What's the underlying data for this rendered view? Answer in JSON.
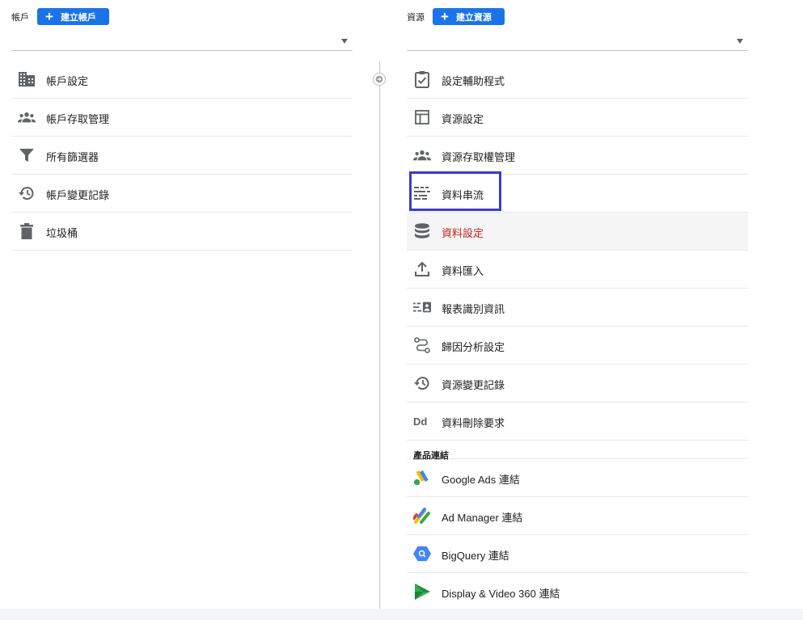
{
  "account": {
    "label": "帳戶",
    "create_button": "建立帳戶",
    "items": [
      {
        "label": "帳戶設定",
        "icon": "building-icon"
      },
      {
        "label": "帳戶存取管理",
        "icon": "people-icon"
      },
      {
        "label": "所有篩選器",
        "icon": "filter-icon"
      },
      {
        "label": "帳戶變更記錄",
        "icon": "history-icon"
      },
      {
        "label": "垃圾桶",
        "icon": "trash-icon"
      }
    ]
  },
  "property": {
    "label": "資源",
    "create_button": "建立資源",
    "items": [
      {
        "label": "設定輔助程式",
        "icon": "checklist-icon"
      },
      {
        "label": "資源設定",
        "icon": "layout-icon"
      },
      {
        "label": "資源存取權管理",
        "icon": "people-icon"
      },
      {
        "label": "資料串流",
        "icon": "data-stream-icon"
      },
      {
        "label": "資料設定",
        "icon": "database-icon"
      },
      {
        "label": "資料匯入",
        "icon": "upload-icon"
      },
      {
        "label": "報表識別資訊",
        "icon": "reporting-identity-icon"
      },
      {
        "label": "歸因分析設定",
        "icon": "attribution-icon"
      },
      {
        "label": "資源變更記錄",
        "icon": "history-icon"
      },
      {
        "label": "資料刪除要求",
        "icon": "data-deletion-icon"
      }
    ],
    "product_links_header": "產品連結",
    "product_links": [
      {
        "label": "Google Ads 連結",
        "icon": "google-ads-icon"
      },
      {
        "label": "Ad Manager 連結",
        "icon": "ad-manager-icon"
      },
      {
        "label": "BigQuery 連結",
        "icon": "bigquery-icon"
      },
      {
        "label": "Display & Video 360 連結",
        "icon": "display-video-360-icon"
      }
    ]
  },
  "active_item": "資料設定",
  "colors": {
    "primary": "#1a73e8",
    "active_text": "#c5221f",
    "highlight_box": "#3c3cc8",
    "icon_gray": "#5f6368"
  }
}
